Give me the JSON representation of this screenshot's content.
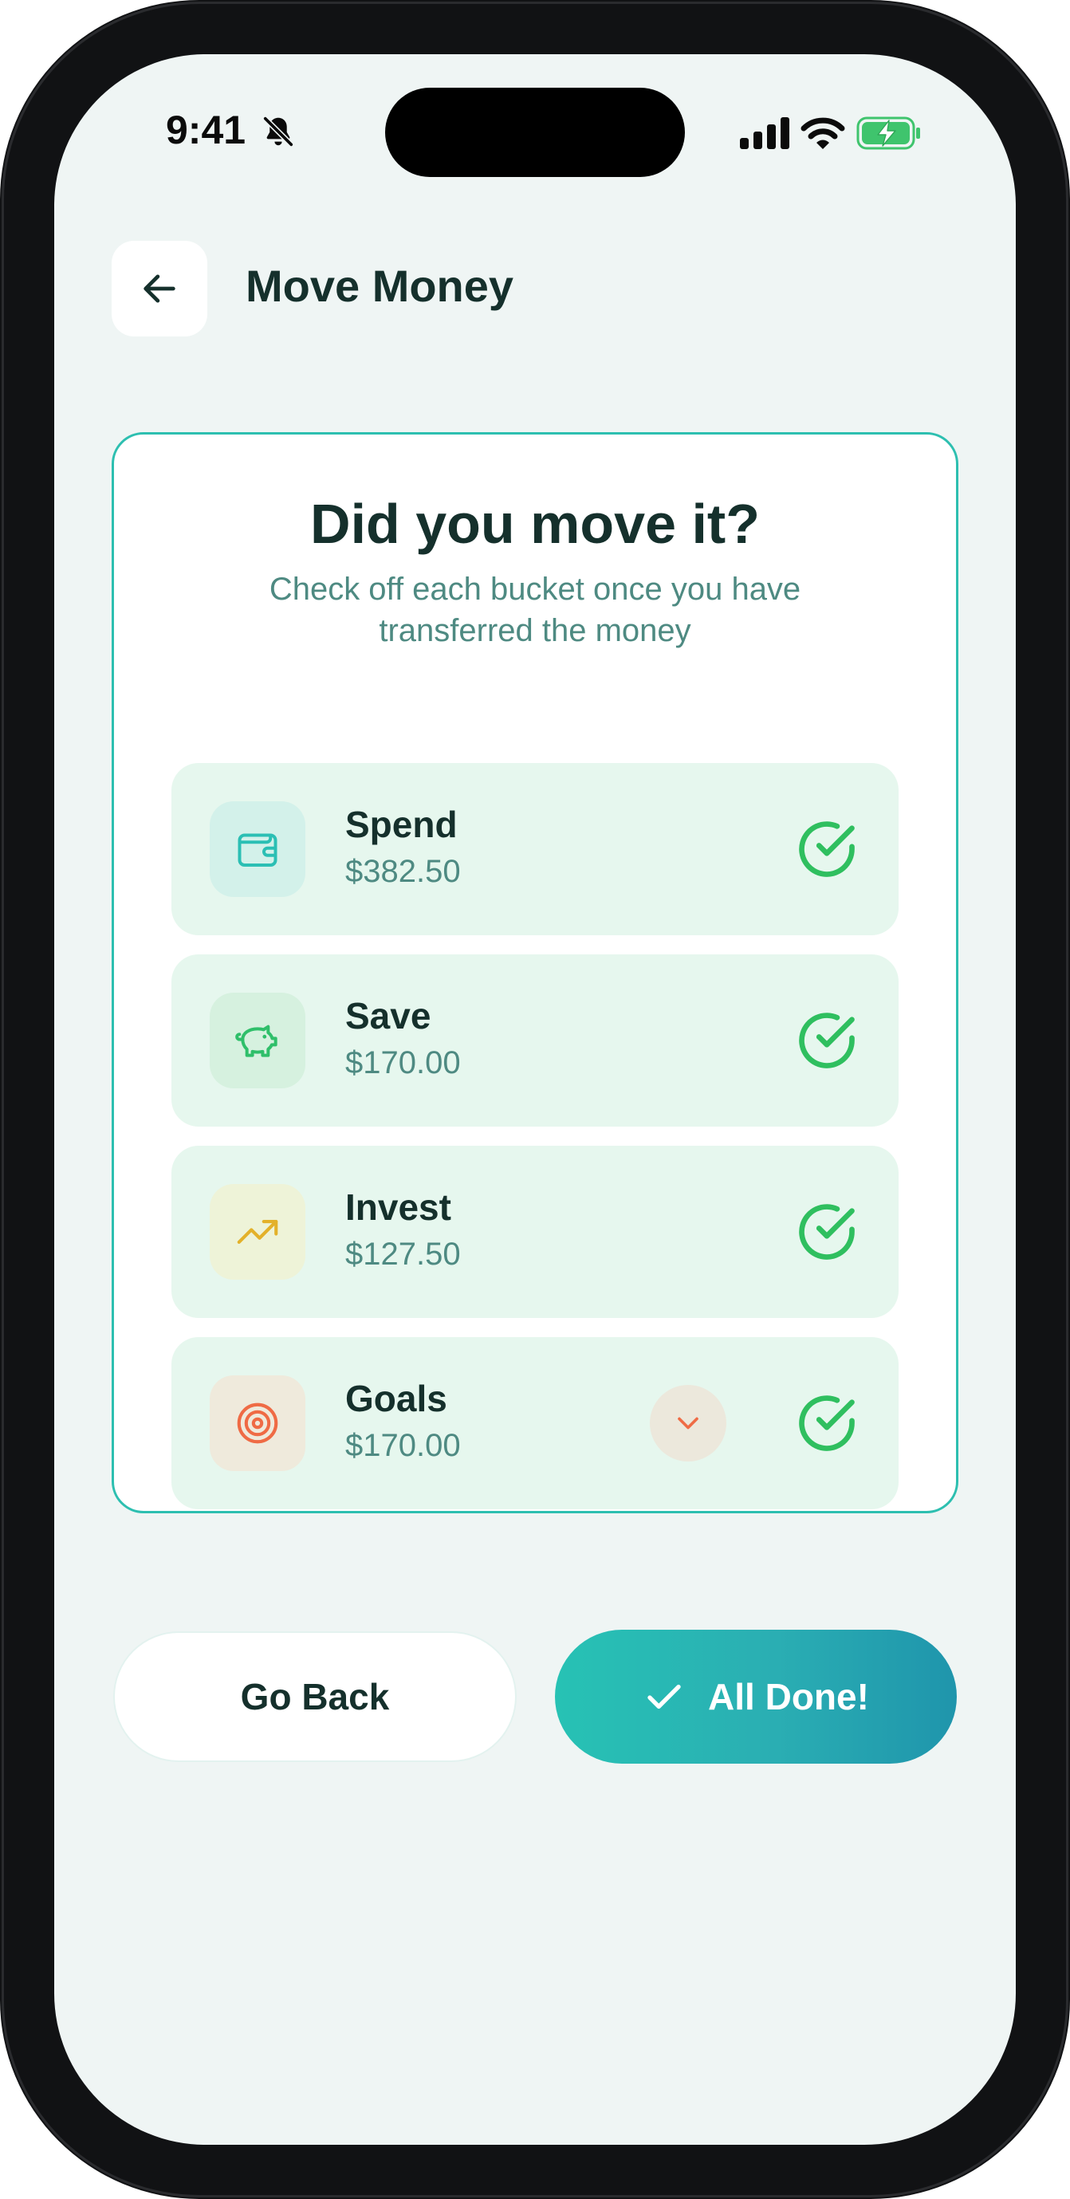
{
  "status_bar": {
    "time": "9:41",
    "icons": [
      "bell-slash-icon",
      "cellular-signal-icon",
      "wifi-icon",
      "battery-charging-icon"
    ]
  },
  "header": {
    "back_icon": "arrow-left-icon",
    "title": "Move Money"
  },
  "card": {
    "title": "Did you move it?",
    "subtitle": "Check off each bucket once you have transferred the money",
    "buckets": [
      {
        "name": "Spend",
        "amount": "$382.50",
        "icon": "wallet-icon",
        "icon_color": "#2bbfb4",
        "icon_bg": "#d3f1ea",
        "checked": true
      },
      {
        "name": "Save",
        "amount": "$170.00",
        "icon": "piggy-bank-icon",
        "icon_color": "#2fbf6a",
        "icon_bg": "#d6f1df",
        "checked": true
      },
      {
        "name": "Invest",
        "amount": "$127.50",
        "icon": "trending-up-icon",
        "icon_color": "#e3b12a",
        "icon_bg": "#eef3d8",
        "checked": true
      },
      {
        "name": "Goals",
        "amount": "$170.00",
        "icon": "target-icon",
        "icon_color": "#ef6b45",
        "icon_bg": "#efeadc",
        "checked": true,
        "has_expand": true
      }
    ]
  },
  "actions": {
    "back_label": "Go Back",
    "done_label": "All Done!"
  },
  "colors": {
    "accent": "#2dbfb0",
    "check": "#2fbf5f",
    "title_text": "#15302c",
    "muted_text": "#4e8a82",
    "bucket_bg": "#e6f7ee",
    "screen_bg": "#eff5f4"
  }
}
